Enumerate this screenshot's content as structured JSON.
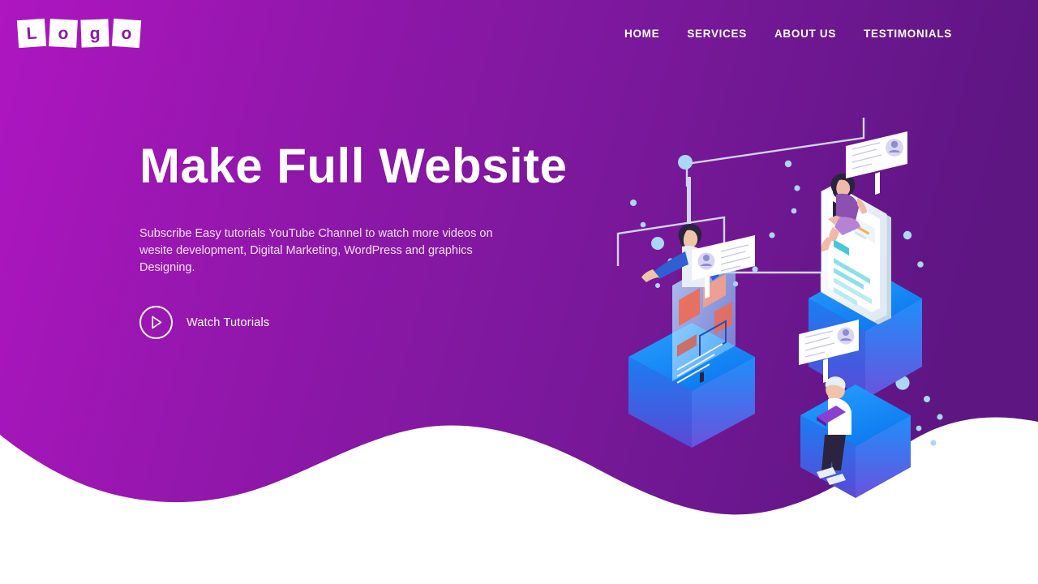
{
  "theme": {
    "gradient_from": "#a917bd",
    "gradient_mid": "#8318a0",
    "gradient_to": "#5f1684",
    "wave_color": "#ffffff",
    "text_on_dark": "#ffffff",
    "paragraph_color": "#f3e4f7",
    "illustration_blue": "#1e90ff",
    "illustration_blue_dark": "#1565d8",
    "illustration_line": "#cfd6f5",
    "illustration_dot": "#a9d7f5",
    "logo_letter_color": "#8d17a8"
  },
  "header": {
    "logo": {
      "name": "Logo",
      "tiles": [
        "L",
        "o",
        "g",
        "o"
      ]
    },
    "nav": [
      {
        "label": "HOME",
        "name": "nav-home"
      },
      {
        "label": "SERVICES",
        "name": "nav-services"
      },
      {
        "label": "ABOUT US",
        "name": "nav-about-us"
      },
      {
        "label": "TESTIMONIALS",
        "name": "nav-testimonials"
      }
    ]
  },
  "hero": {
    "title": "Make Full Website",
    "paragraph": "Subscribe Easy tutorials YouTube Channel to watch more videos on wesite development, Digital Marketing, WordPress and graphics Designing.",
    "cta": {
      "label": "Watch Tutorials",
      "icon": "play-icon"
    }
  },
  "illustration": {
    "alt": "Isometric illustration of people building a website on blue cube pedestals",
    "scene_items": [
      {
        "name": "phone-mockup-pedestal",
        "figure": "woman-sitting-on-phone"
      },
      {
        "name": "screen-panel-pedestal",
        "figure": "man-behind-screen"
      },
      {
        "name": "laptop-cube-pedestal",
        "figure": "person-with-laptop"
      }
    ],
    "notification_cards": 3,
    "decor": {
      "dots": 16,
      "connector_lines": 2
    }
  }
}
